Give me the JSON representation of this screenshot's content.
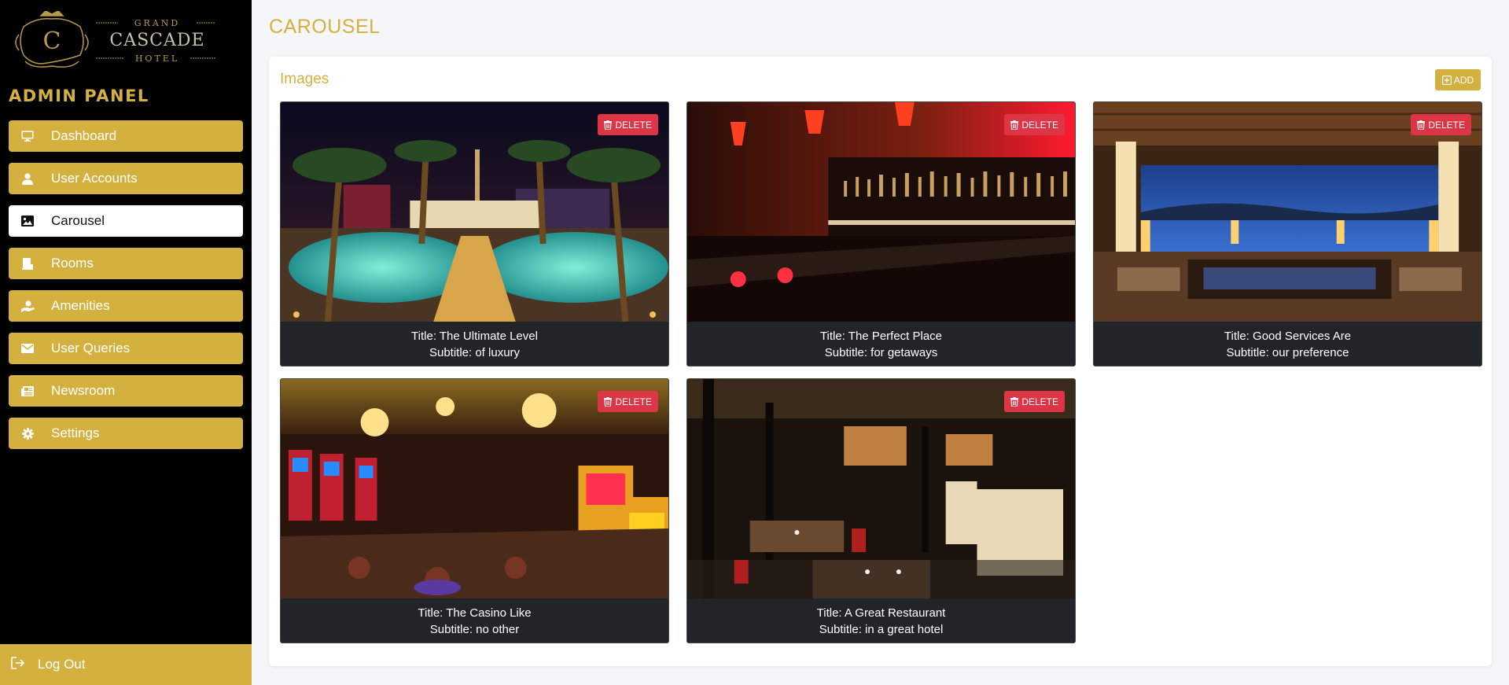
{
  "brand": {
    "line1": "GRAND",
    "line2": "CASCADE",
    "line3": "HOTEL",
    "monogram": "C"
  },
  "sidebar": {
    "title": "ADMIN PANEL",
    "items": [
      {
        "label": "Dashboard",
        "icon": "monitor-icon",
        "active": false
      },
      {
        "label": "User Accounts",
        "icon": "user-icon",
        "active": false
      },
      {
        "label": "Carousel",
        "icon": "image-icon",
        "active": true
      },
      {
        "label": "Rooms",
        "icon": "hotel-icon",
        "active": false
      },
      {
        "label": "Amenities",
        "icon": "hand-holding-icon",
        "active": false
      },
      {
        "label": "User Queries",
        "icon": "envelope-icon",
        "active": false
      },
      {
        "label": "Newsroom",
        "icon": "newspaper-icon",
        "active": false
      },
      {
        "label": "Settings",
        "icon": "gear-icon",
        "active": false
      }
    ],
    "logout": "Log Out"
  },
  "page": {
    "title": "CAROUSEL"
  },
  "images_card": {
    "title": "Images",
    "add_label": "ADD",
    "delete_label": "DELETE",
    "items": [
      {
        "title": "Title: The Ultimate Level",
        "subtitle": "Subtitle: of luxury",
        "scene": "pool"
      },
      {
        "title": "Title: The Perfect Place",
        "subtitle": "Subtitle: for getaways",
        "scene": "bar"
      },
      {
        "title": "Title: Good Services Are",
        "subtitle": "Subtitle: our preference",
        "scene": "lounge"
      },
      {
        "title": "Title: The Casino Like",
        "subtitle": "Subtitle: no other",
        "scene": "casino"
      },
      {
        "title": "Title: A Great Restaurant",
        "subtitle": "Subtitle: in a great hotel",
        "scene": "restaurant"
      }
    ]
  },
  "colors": {
    "accent": "#d4b13f",
    "danger": "#dc3545",
    "sidebar_bg": "#000000",
    "caption_bg": "#212529"
  }
}
